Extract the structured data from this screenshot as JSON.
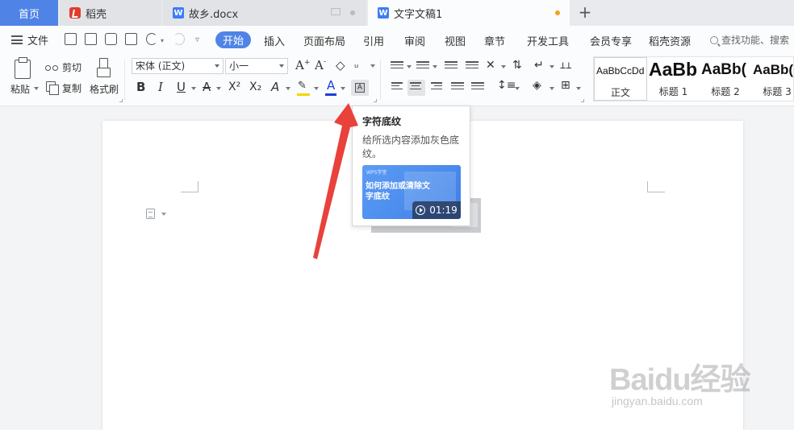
{
  "tabs": {
    "home": "首页",
    "daoke": "稻壳",
    "doc1": "故乡.docx",
    "doc2": "文字文稿1",
    "new_tab": "+"
  },
  "menu": {
    "file": "文件",
    "items": [
      "开始",
      "插入",
      "页面布局",
      "引用",
      "审阅",
      "视图",
      "章节",
      "开发工具",
      "会员专享",
      "稻壳资源"
    ],
    "search": "查找功能、搜索"
  },
  "ribbon": {
    "paste": "粘贴",
    "cut": "剪切",
    "copy": "复制",
    "format_painter": "格式刷",
    "font_name": "宋体 (正文)",
    "font_size": "小一",
    "grow_font": "A",
    "shrink_font": "A",
    "bold": "B",
    "italic": "I",
    "underline": "U",
    "strikethrough": "A",
    "superscript": "X²",
    "subscript": "X₂",
    "text_effect": "A",
    "font_color": "A",
    "char_shading": "A",
    "highlight_color": "#f5d400",
    "font_color_value": "#1a3fd8"
  },
  "styles": [
    {
      "sample": "AaBbCcDd",
      "name": "正文"
    },
    {
      "sample": "AaBb",
      "name": "标题 1"
    },
    {
      "sample": "AaBb(",
      "name": "标题 2"
    },
    {
      "sample": "AaBb(",
      "name": "标题 3"
    }
  ],
  "tooltip": {
    "title": "字符底纹",
    "description": "给所选内容添加灰色底纹。",
    "video_brand": "WPS学堂",
    "video_title": "如何添加或清除文字底纹",
    "video_duration": "01:19"
  },
  "watermark": {
    "logo": "Baidu经验",
    "url": "jingyan.baidu.com"
  },
  "colors": {
    "accent": "#4f84e6",
    "arrow": "#e8423b"
  }
}
